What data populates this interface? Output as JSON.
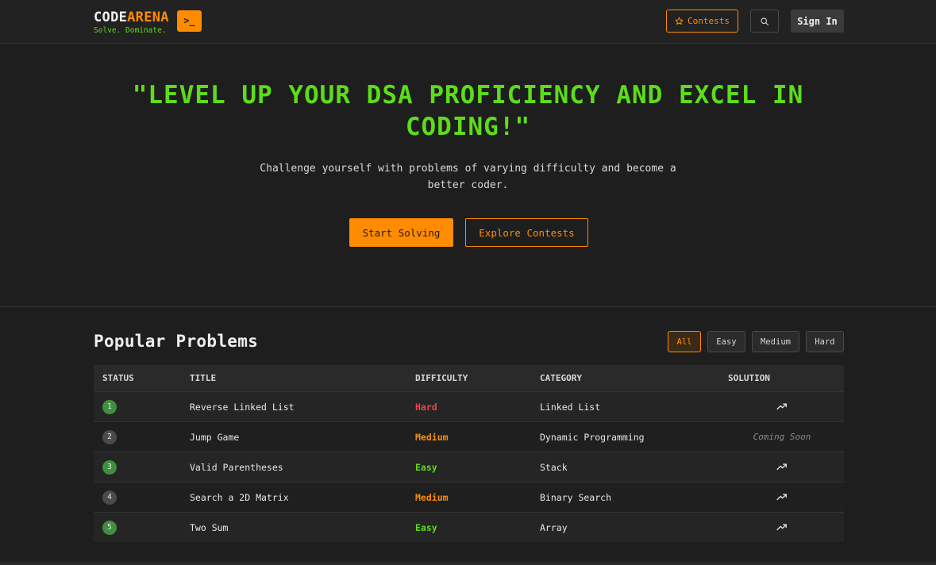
{
  "header": {
    "logo_part1": "CODE",
    "logo_part2": "ARENA",
    "tagline": "Solve. Dominate.",
    "badge": ">_",
    "contests_label": "Contests",
    "signin_label": "Sign In"
  },
  "hero": {
    "title": "\"LEVEL UP YOUR DSA PROFICIENCY AND EXCEL IN CODING!\"",
    "subtitle": "Challenge yourself with problems of varying difficulty and become a better coder.",
    "start_label": "Start Solving",
    "explore_label": "Explore Contests"
  },
  "problems": {
    "heading": "Popular Problems",
    "filters": [
      "All",
      "Easy",
      "Medium",
      "Hard"
    ],
    "active_filter": "All",
    "columns": [
      "STATUS",
      "TITLE",
      "DIFFICULTY",
      "CATEGORY",
      "SOLUTION"
    ],
    "rows": [
      {
        "num": "1",
        "solved": true,
        "title": "Reverse Linked List",
        "difficulty": "Hard",
        "category": "Linked List",
        "solution": "trending-icon"
      },
      {
        "num": "2",
        "solved": false,
        "title": "Jump Game",
        "difficulty": "Medium",
        "category": "Dynamic Programming",
        "solution": "Coming Soon"
      },
      {
        "num": "3",
        "solved": true,
        "title": "Valid Parentheses",
        "difficulty": "Easy",
        "category": "Stack",
        "solution": "trending-icon"
      },
      {
        "num": "4",
        "solved": false,
        "title": "Search a 2D Matrix",
        "difficulty": "Medium",
        "category": "Binary Search",
        "solution": "trending-icon"
      },
      {
        "num": "5",
        "solved": true,
        "title": "Two Sum",
        "difficulty": "Easy",
        "category": "Array",
        "solution": "trending-icon"
      }
    ]
  },
  "colors": {
    "accent": "#ff8c00",
    "green": "#5ddc1a",
    "hard": "#ef4444",
    "background": "#1e1e1e"
  }
}
